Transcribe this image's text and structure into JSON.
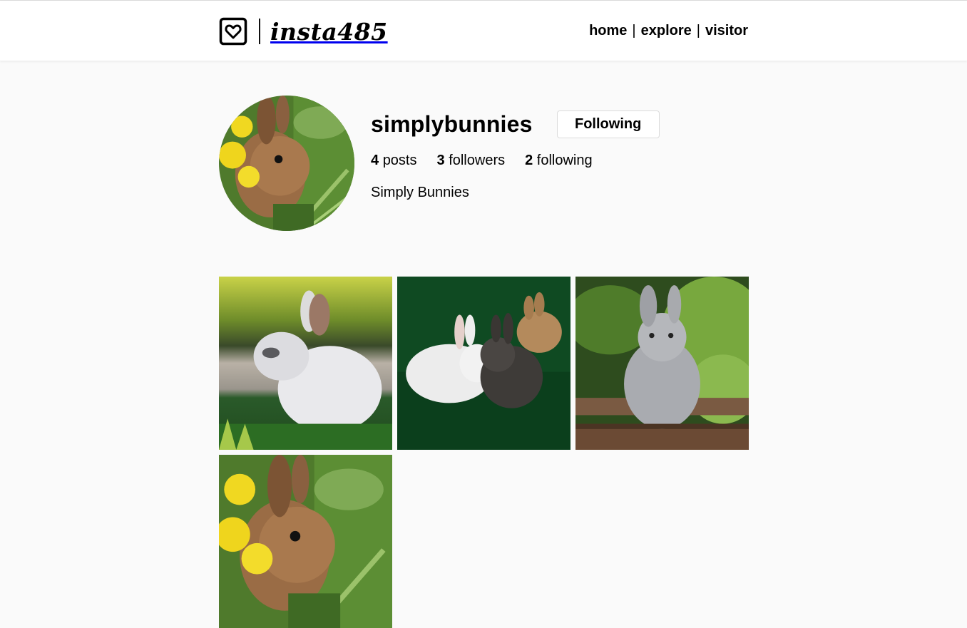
{
  "header": {
    "brand_name": "insta485",
    "logo_icon": "heart-in-square-icon",
    "nav": [
      {
        "label": "home"
      },
      {
        "label": "explore"
      },
      {
        "label": "visitor"
      }
    ],
    "separator": "|"
  },
  "profile": {
    "username": "simplybunnies",
    "follow_button_label": "Following",
    "stats": {
      "posts_count": "4",
      "posts_label": "posts",
      "followers_count": "3",
      "followers_label": "followers",
      "following_count": "2",
      "following_label": "following"
    },
    "fullname": "Simply Bunnies",
    "avatar_alt": "brown bunny among yellow flowers"
  },
  "posts": [
    {
      "alt": "white bunny sitting on grass"
    },
    {
      "alt": "white and black bunnies cuddling on grass"
    },
    {
      "alt": "gray bunny sitting on a log"
    },
    {
      "alt": "brown bunny among yellow flowers"
    }
  ],
  "colors": {
    "page_bg": "#fafafa",
    "header_bg": "#ffffff",
    "button_border": "#dbdbdb"
  }
}
